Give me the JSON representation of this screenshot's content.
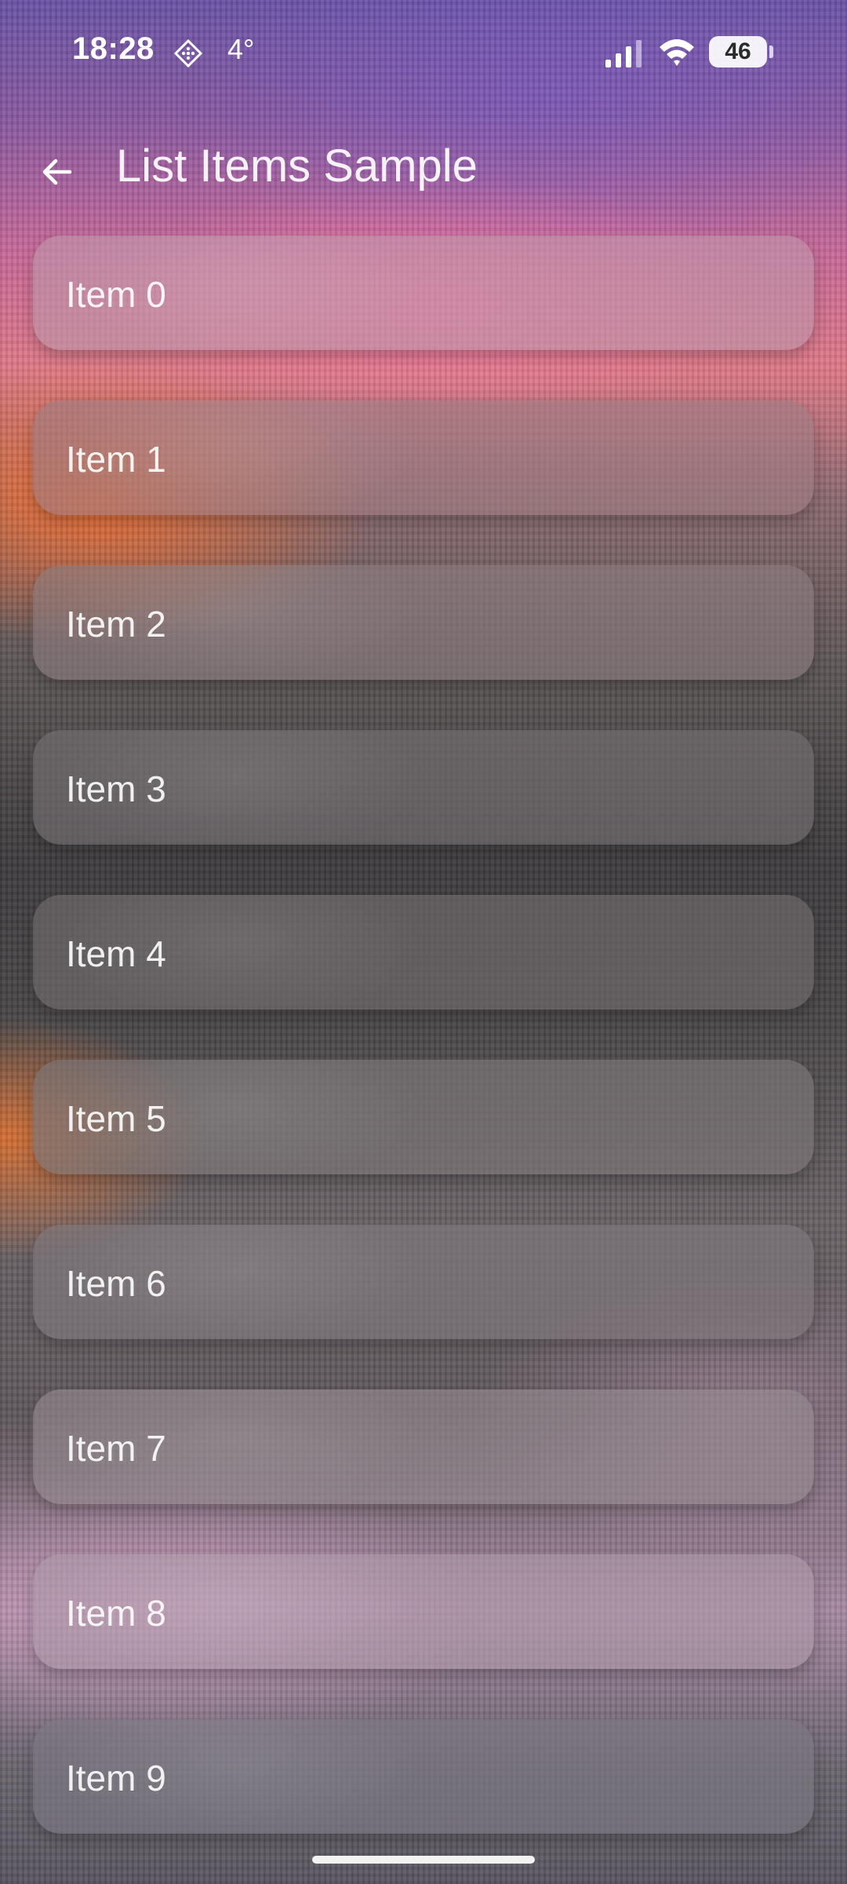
{
  "status_bar": {
    "time": "18:28",
    "temperature": "4°",
    "battery_level": "46",
    "icons": [
      "navigation-diamond-icon",
      "signal-icon",
      "wifi-icon",
      "battery-icon"
    ]
  },
  "app_bar": {
    "title": "List Items Sample",
    "back_icon": "arrow-back-icon"
  },
  "list": {
    "items": [
      {
        "label": "Item 0"
      },
      {
        "label": "Item 1"
      },
      {
        "label": "Item 2"
      },
      {
        "label": "Item 3"
      },
      {
        "label": "Item 4"
      },
      {
        "label": "Item 5"
      },
      {
        "label": "Item 6"
      },
      {
        "label": "Item 7"
      },
      {
        "label": "Item 8"
      },
      {
        "label": "Item 9"
      }
    ]
  },
  "colors": {
    "text": "#ffffff",
    "card_tint": "#968c92"
  }
}
